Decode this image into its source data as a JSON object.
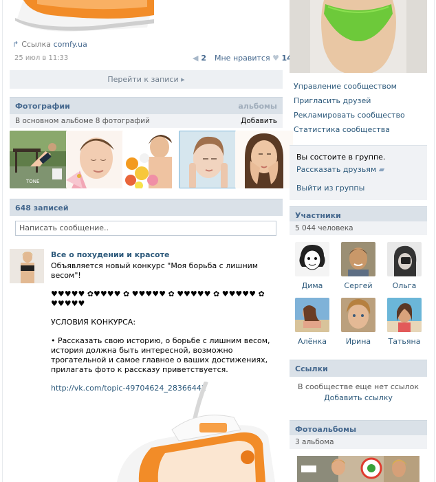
{
  "left": {
    "link_label": "Ссылка",
    "link_domain": "comfy.ua",
    "post_date": "25 июл в 11:33",
    "share_count": "2",
    "like_label": "Мне нравится",
    "like_count": "14",
    "goto_post": "Перейти к записи",
    "photos": {
      "title": "Фотографии",
      "albums_link": "альбомы",
      "subtitle": "В основном альбоме 8 фотографий",
      "add": "Добавить",
      "thumb_caption": "TONE"
    },
    "posts": {
      "title": "648 записей",
      "placeholder": "Написать сообщение.."
    },
    "post": {
      "author": "Все о похудении и красоте",
      "line1": "Объявляется новый конкурс \"Моя борьба с лишним весом\"!",
      "hearts": "♥♥♥♥♥ ✿♥♥♥♥ ✿ ♥♥♥♥♥ ✿ ♥♥♥♥♥ ✿ ♥♥♥♥♥ ✿ ♥♥♥♥♥",
      "conditions": "УСЛОВИЯ КОНКУРСА:",
      "body": "• Рассказать свою историю, о борьбе с лишним весом, история должна быть интересной, возможно трогательной и самое главное о ваших достижениях, прилагать фото к рассказу приветствуется.",
      "link": "http://vk.com/topic-49704624_28366442"
    }
  },
  "right": {
    "menu": [
      "Управление сообществом",
      "Пригласить друзей",
      "Рекламировать сообщество",
      "Статистика сообщества"
    ],
    "membership": {
      "status": "Вы состоите в группе.",
      "tell_friends": "Рассказать друзьям",
      "leave": "Выйти из группы"
    },
    "members": {
      "title": "Участники",
      "count": "5 044 человека",
      "people": [
        "Дима",
        "Сергей",
        "Ольга",
        "Алёнка",
        "Ирина",
        "Татьяна"
      ]
    },
    "links": {
      "title": "Ссылки",
      "empty": "В сообществе еще нет ссылок",
      "add": "Добавить ссылку"
    },
    "albums": {
      "title": "Фотоальбомы",
      "count": "3 альбома"
    }
  },
  "colors": {
    "link_blue": "#2b587a",
    "header_bg": "#dae1e8",
    "sub_bg": "#f0f2f5",
    "orange": "#f28c28"
  }
}
